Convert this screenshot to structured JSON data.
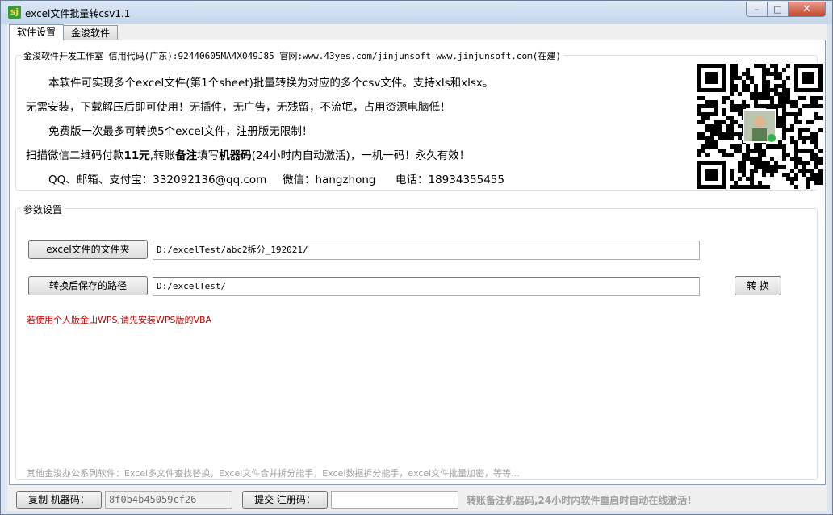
{
  "window": {
    "title": "excel文件批量转csv1.1",
    "icon": "sj-app-icon",
    "controls": {
      "minimize": "–",
      "maximize": "□",
      "close": "✕"
    }
  },
  "tabs": [
    {
      "label": "软件设置",
      "active": true
    },
    {
      "label": "金浚软件",
      "active": false
    }
  ],
  "about": {
    "legend": "金浚软件开发工作室 信用代码(广东):92440605MA4X049J85 官网:www.43yes.com/jinjunsoft  www.jinjunsoft.com(在建)",
    "line1": "本软件可实现多个excel文件(第1个sheet)批量转换为对应的多个csv文件。支持xls和xlsx。",
    "line2": "无需安装，下载解压后即可使用！无插件，无广告，无残留，不流氓，占用资源电脑低！",
    "line3": "免费版一次最多可转换5个excel文件，注册版无限制！",
    "line4_prefix": "扫描微信二维码付款",
    "line4_price": "11元",
    "line4_mid1": ",转账",
    "line4_bold1": "备注",
    "line4_mid2": "填写",
    "line4_bold2": "机器码",
    "line4_suffix": "(24小时内自动激活)，一机一码！永久有效！",
    "contact_qq": "QQ、邮箱、支付宝：332092136@qq.com",
    "contact_wechat": "微信：hangzhong",
    "contact_phone": "电话：18934355455",
    "qr_icon": "wechat-qr-code"
  },
  "params": {
    "legend": "参数设置",
    "source_button": "excel文件的文件夹",
    "source_path": "D:/excelTest/abc2拆分_192021/",
    "target_button": "转换后保存的路径",
    "target_path": "D:/excelTest/",
    "convert_button": "转 换",
    "warning": "若使用个人版金山WPS,请先安装WPS版的VBA",
    "other_products": "其他金浚办公系列软件：Excel多文件查找替换，Excel文件合并拆分能手，Excel数据拆分能手，excel文件批量加密，等等..."
  },
  "bottom": {
    "copy_button": "复制 机器码：",
    "machine_code": "8f0b4b45059cf26",
    "submit_button": "提交 注册码：",
    "reg_code": "",
    "note": "转账备注机器码,24小时内软件重启时自动在线激活!"
  },
  "colors": {
    "warning": "#cc0000",
    "muted": "#a0a0a0",
    "titlebar": "#c4d6ec"
  }
}
